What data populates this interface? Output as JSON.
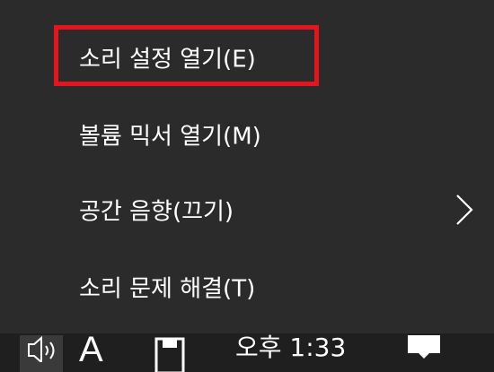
{
  "context_menu": {
    "items": [
      {
        "label": "소리 설정 열기(E)",
        "highlighted": true,
        "has_submenu": false
      },
      {
        "label": "볼륨 믹서 열기(M)",
        "highlighted": false,
        "has_submenu": false
      },
      {
        "label": "공간 음향(끄기)",
        "highlighted": false,
        "has_submenu": true
      },
      {
        "label": "소리 문제 해결(T)",
        "highlighted": false,
        "has_submenu": false
      }
    ],
    "highlight_color": "#e8141d",
    "background_color": "#2b2b2b"
  },
  "taskbar": {
    "ime_language": "A",
    "clock": "오후 1:33",
    "icons": [
      "volume-icon",
      "ime-mode-icon",
      "notification-icon"
    ]
  }
}
